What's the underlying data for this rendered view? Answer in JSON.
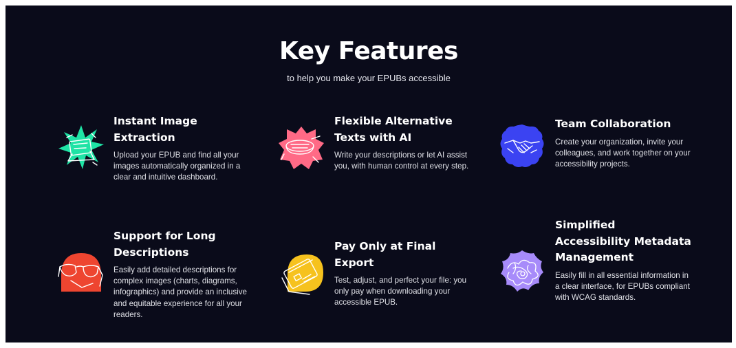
{
  "header": {
    "title": "Key Features",
    "subtitle": "to help you make your EPUBs accessible"
  },
  "colors": {
    "background": "#0a0b1a",
    "green": "#1fe3a5",
    "pink": "#ff6a86",
    "blue": "#3b43f2",
    "red": "#ee4530",
    "yellow": "#f6c21e",
    "purple": "#a78bfa"
  },
  "features": [
    {
      "icon": "image-extraction-icon",
      "title": "Instant Image Extraction",
      "description": "Upload your EPUB and find all your images automatically organized in a clear and intuitive dashboard."
    },
    {
      "icon": "ai-alt-text-icon",
      "title": "Flexible Alternative Texts with AI",
      "description": "Write your descriptions or let AI assist you, with human control at every step."
    },
    {
      "icon": "handshake-icon",
      "title": "Team Collaboration",
      "description": "Create your organization, invite your colleagues, and work together on your accessibility projects."
    },
    {
      "icon": "glasses-icon",
      "title": "Support for Long Descriptions",
      "description": "Easily add detailed descriptions for complex images (charts, diagrams, infographics) and provide an inclusive and equitable experience for all your readers."
    },
    {
      "icon": "credit-card-icon",
      "title": "Pay Only at Final Export",
      "description": "Test, adjust, and perfect your file: you only pay when downloading your accessible EPUB."
    },
    {
      "icon": "metadata-scribble-icon",
      "title": "Simplified Accessibility Metadata Management",
      "description": "Easily fill in all essential information in a clear interface, for EPUBs compliant with WCAG standards."
    }
  ]
}
